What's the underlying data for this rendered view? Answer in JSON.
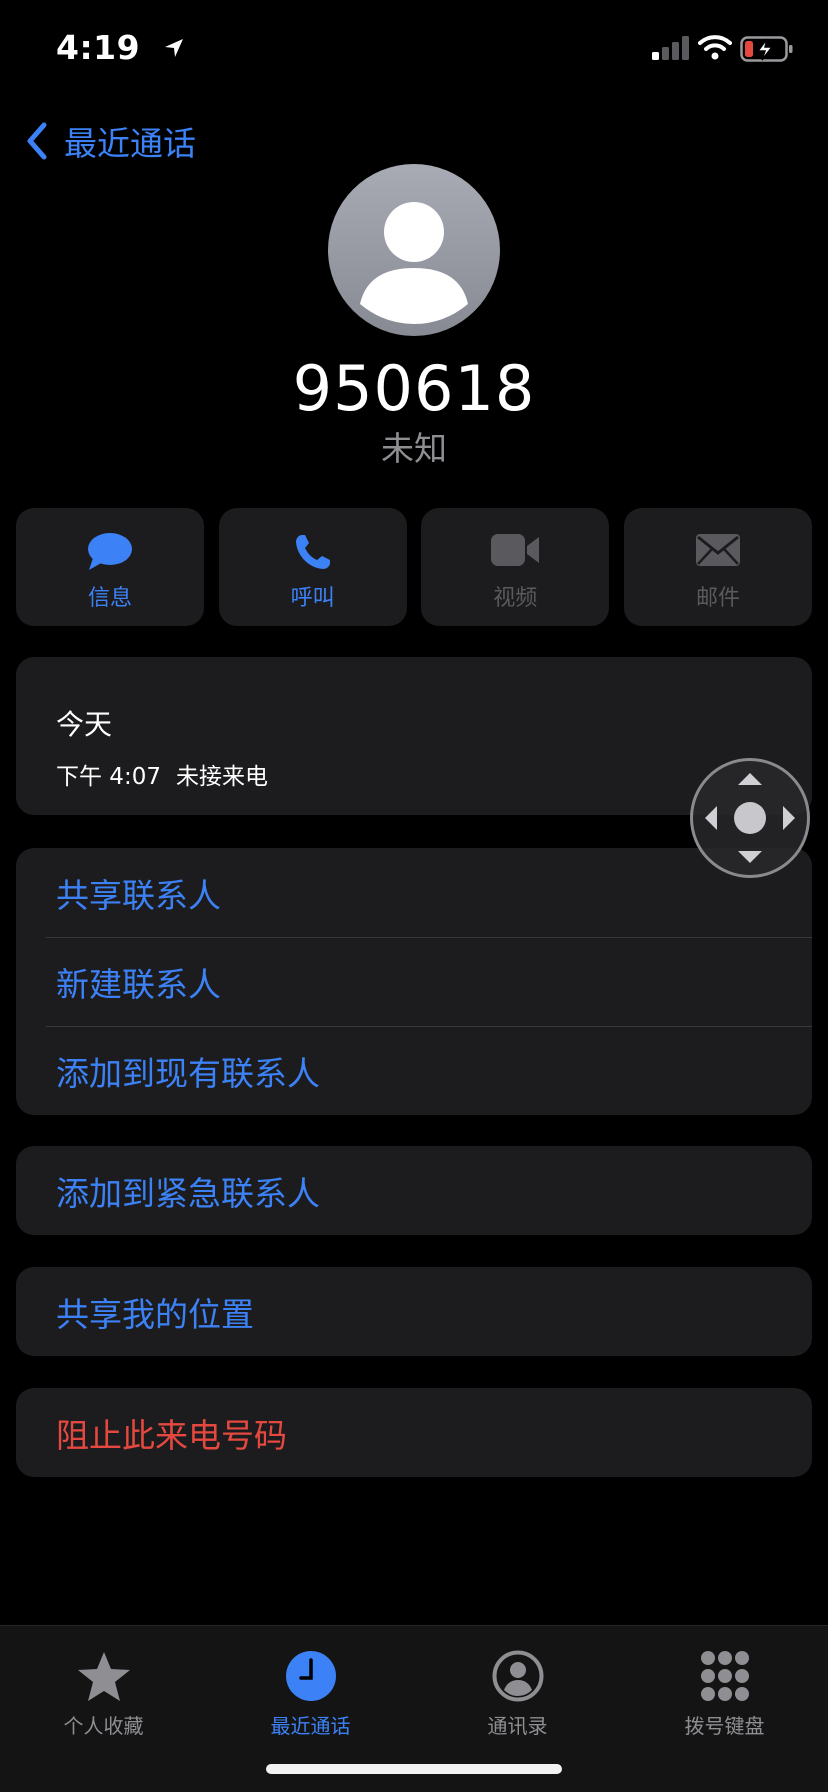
{
  "status_bar": {
    "time": "4:19"
  },
  "nav": {
    "back_label": "最近通话"
  },
  "caller": {
    "number": "950618",
    "label": "未知"
  },
  "actions": [
    {
      "label": "信息",
      "icon": "message-icon",
      "enabled": true
    },
    {
      "label": "呼叫",
      "icon": "phone-icon",
      "enabled": true
    },
    {
      "label": "视频",
      "icon": "video-icon",
      "enabled": false
    },
    {
      "label": "邮件",
      "icon": "mail-icon",
      "enabled": false
    }
  ],
  "call_log": {
    "date": "今天",
    "time": "下午 4:07",
    "status": "未接来电"
  },
  "contact_options": [
    "共享联系人",
    "新建联系人",
    "添加到现有联系人"
  ],
  "emergency_option": "添加到紧急联系人",
  "location_option": "共享我的位置",
  "block_option": "阻止此来电号码",
  "tabs": [
    {
      "label": "个人收藏",
      "icon": "star-icon",
      "active": false
    },
    {
      "label": "最近通话",
      "icon": "clock-icon",
      "active": true
    },
    {
      "label": "通讯录",
      "icon": "contacts-icon",
      "active": false
    },
    {
      "label": "拨号键盘",
      "icon": "keypad-icon",
      "active": false
    }
  ],
  "colors": {
    "accent": "#3c82f6",
    "danger": "#e5483f",
    "card": "#1c1c1e",
    "background": "#000000"
  }
}
